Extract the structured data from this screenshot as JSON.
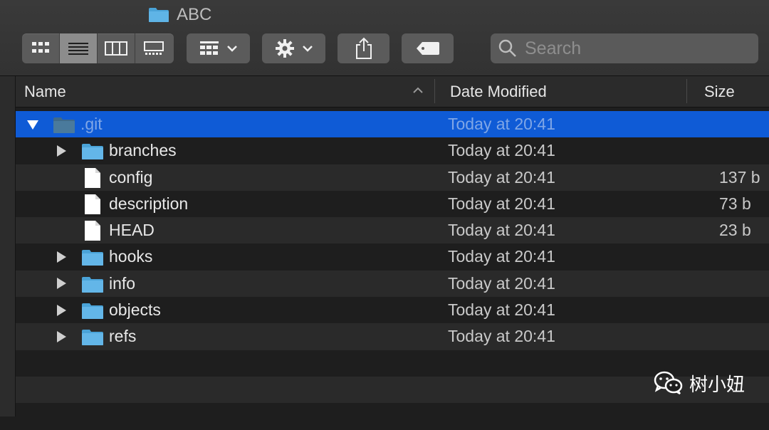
{
  "window": {
    "title": "ABC",
    "folder_icon": "folder-icon"
  },
  "toolbar": {
    "view_modes": [
      {
        "name": "icon-view",
        "icon": "grid-icon",
        "active": false
      },
      {
        "name": "list-view",
        "icon": "list-icon",
        "active": true
      },
      {
        "name": "column-view",
        "icon": "columns-icon",
        "active": false
      },
      {
        "name": "gallery-view",
        "icon": "gallery-icon",
        "active": false
      }
    ],
    "group_button_icon": "group-grid-icon",
    "action_button_icon": "gear-icon",
    "share_button_icon": "share-icon",
    "tag_button_icon": "tag-icon",
    "search_placeholder": "Search"
  },
  "columns": {
    "name": "Name",
    "date_modified": "Date Modified",
    "size": "Size"
  },
  "rows": [
    {
      "name": ".git",
      "type": "folder",
      "indent": 0,
      "expanded": true,
      "selected": true,
      "date": "Today at 20:41",
      "size": ""
    },
    {
      "name": "branches",
      "type": "folder",
      "indent": 1,
      "expanded": false,
      "selected": false,
      "date": "Today at 20:41",
      "size": ""
    },
    {
      "name": "config",
      "type": "file",
      "indent": 1,
      "selected": false,
      "date": "Today at 20:41",
      "size": "137 b"
    },
    {
      "name": "description",
      "type": "file",
      "indent": 1,
      "selected": false,
      "date": "Today at 20:41",
      "size": "73 b"
    },
    {
      "name": "HEAD",
      "type": "file",
      "indent": 1,
      "selected": false,
      "date": "Today at 20:41",
      "size": "23 b"
    },
    {
      "name": "hooks",
      "type": "folder",
      "indent": 1,
      "expanded": false,
      "selected": false,
      "date": "Today at 20:41",
      "size": ""
    },
    {
      "name": "info",
      "type": "folder",
      "indent": 1,
      "expanded": false,
      "selected": false,
      "date": "Today at 20:41",
      "size": ""
    },
    {
      "name": "objects",
      "type": "folder",
      "indent": 1,
      "expanded": false,
      "selected": false,
      "date": "Today at 20:41",
      "size": ""
    },
    {
      "name": "refs",
      "type": "folder",
      "indent": 1,
      "expanded": false,
      "selected": false,
      "date": "Today at 20:41",
      "size": ""
    }
  ],
  "watermark": {
    "icon": "wechat-icon",
    "text": "树小妞"
  },
  "colors": {
    "selection": "#0f5bd6",
    "folder": "#4aa3d8"
  }
}
